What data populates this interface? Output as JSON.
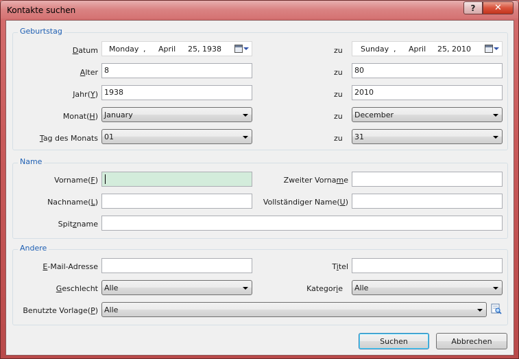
{
  "window": {
    "title": "Kontakte suchen",
    "help_label": "?",
    "close_label": "✕"
  },
  "birthday": {
    "legend": "Geburtstag",
    "date_label": "Datum",
    "date_from": {
      "weekday": "Monday",
      "sep": ",",
      "month": "April",
      "day_year": "25, 1938"
    },
    "date_to": {
      "weekday": "Sunday",
      "sep": ",",
      "month": "April",
      "day_year": "25, 2010"
    },
    "age_label": "Alter",
    "age_from": "8",
    "age_to": "80",
    "year_label": "Jahr(Y)",
    "year_from": "1938",
    "year_to": "2010",
    "month_label": "Monat(H)",
    "month_from": "January",
    "month_to": "December",
    "dom_label": "Tag des Monats",
    "dom_from": "01",
    "dom_to": "31",
    "to_label": "zu"
  },
  "name": {
    "legend": "Name",
    "first_label": "Vorname(F)",
    "first_value": "",
    "middle_label": "Zweiter Vorname",
    "middle_value": "",
    "last_label": "Nachname(L)",
    "last_value": "",
    "full_label": "Vollständiger Name(U)",
    "full_value": "",
    "nick_label": "Spitzname",
    "nick_value": ""
  },
  "other": {
    "legend": "Andere",
    "email_label": "E-Mail-Adresse",
    "email_value": "",
    "title_label": "Titel",
    "title_value": "",
    "gender_label": "Geschlecht",
    "gender_value": "Alle",
    "category_label": "Kategorie",
    "category_value": "Alle",
    "template_label": "Benutzte Vorlage(P)",
    "template_value": "Alle"
  },
  "buttons": {
    "search": "Suchen",
    "cancel": "Abbrechen"
  }
}
